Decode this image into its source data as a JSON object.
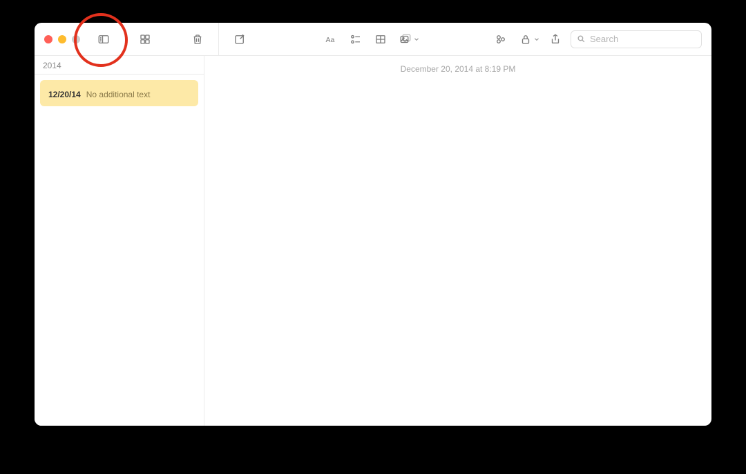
{
  "toolbar": {
    "search_placeholder": "Search"
  },
  "sidebar": {
    "group_header": "2014",
    "notes": [
      {
        "title_glyph": "",
        "date": "12/20/14",
        "preview": "No additional text"
      }
    ]
  },
  "editor": {
    "timestamp": "December 20, 2014 at 8:19 PM",
    "body_glyph": ""
  },
  "annotation": {
    "highlighted_control": "view-toggle-button"
  }
}
